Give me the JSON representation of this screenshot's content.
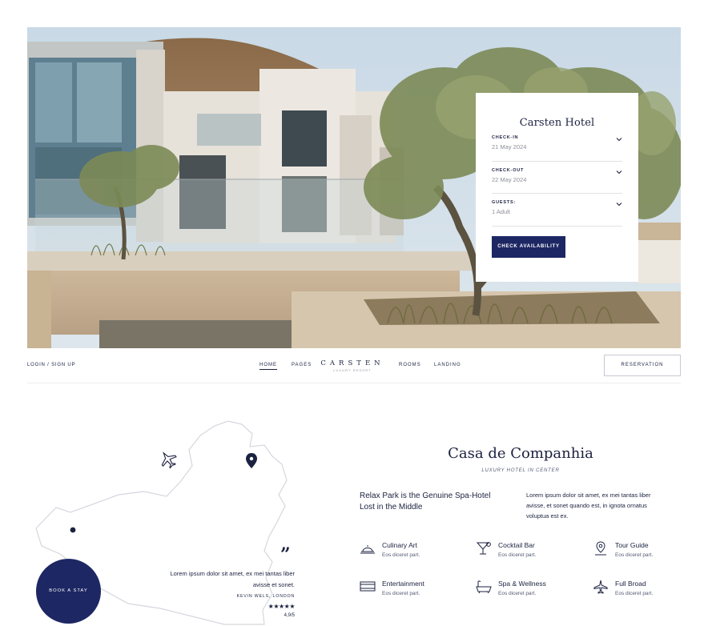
{
  "booking": {
    "title": "Carsten Hotel",
    "checkin_label": "CHECK-IN",
    "checkin_value": "21 May 2024",
    "checkout_label": "CHECK-OUT",
    "checkout_value": "22 May 2024",
    "guests_label": "GUESTS:",
    "guests_value": "1 Adult",
    "button": "CHECK AVAILABILITY"
  },
  "nav": {
    "login": "LOGIN / SIGN UP",
    "links": [
      "HOME",
      "PAGES",
      "ROOMS",
      "LANDING"
    ],
    "logo": "CARSTEN",
    "logo_sub": "LUXURY RESORT",
    "reserve": "RESERVATION"
  },
  "map": {
    "book_button": "BOOK A STAY",
    "quote_mark": "”",
    "quote": "Lorem ipsum dolor sit amet, ex mei tantas liber avisse et sonet.",
    "author": "KEVIN WELS, LONDON",
    "stars": "★★★★★",
    "rating": "4,9/5"
  },
  "about": {
    "title": "Casa de Companhia",
    "subtitle": "LUXURY HOTEL IN CENTER",
    "lead": "Relax Park is the Genuine Spa-Hotel Lost in the Middle",
    "body": "Lorem ipsum dolor sit amet, ex mei tantas liber avisse, et sonet quando est, in ignota ornatus voluptua est ex."
  },
  "amenities": [
    {
      "title": "Culinary Art",
      "desc": "Eos diceret part.",
      "icon": "cloche-icon"
    },
    {
      "title": "Cocktail Bar",
      "desc": "Eos diceret part.",
      "icon": "cocktail-icon"
    },
    {
      "title": "Tour Guide",
      "desc": "Eos diceret part.",
      "icon": "map-pin-icon"
    },
    {
      "title": "Entertainment",
      "desc": "Eos diceret part.",
      "icon": "screen-icon"
    },
    {
      "title": "Spa & Wellness",
      "desc": "Eos diceret part.",
      "icon": "bathtub-icon"
    },
    {
      "title": "Full Broad",
      "desc": "Eos diceret part.",
      "icon": "airplane-icon"
    }
  ],
  "colors": {
    "navy": "#1d2763",
    "text": "#1b2240",
    "muted": "#8d8f99"
  }
}
